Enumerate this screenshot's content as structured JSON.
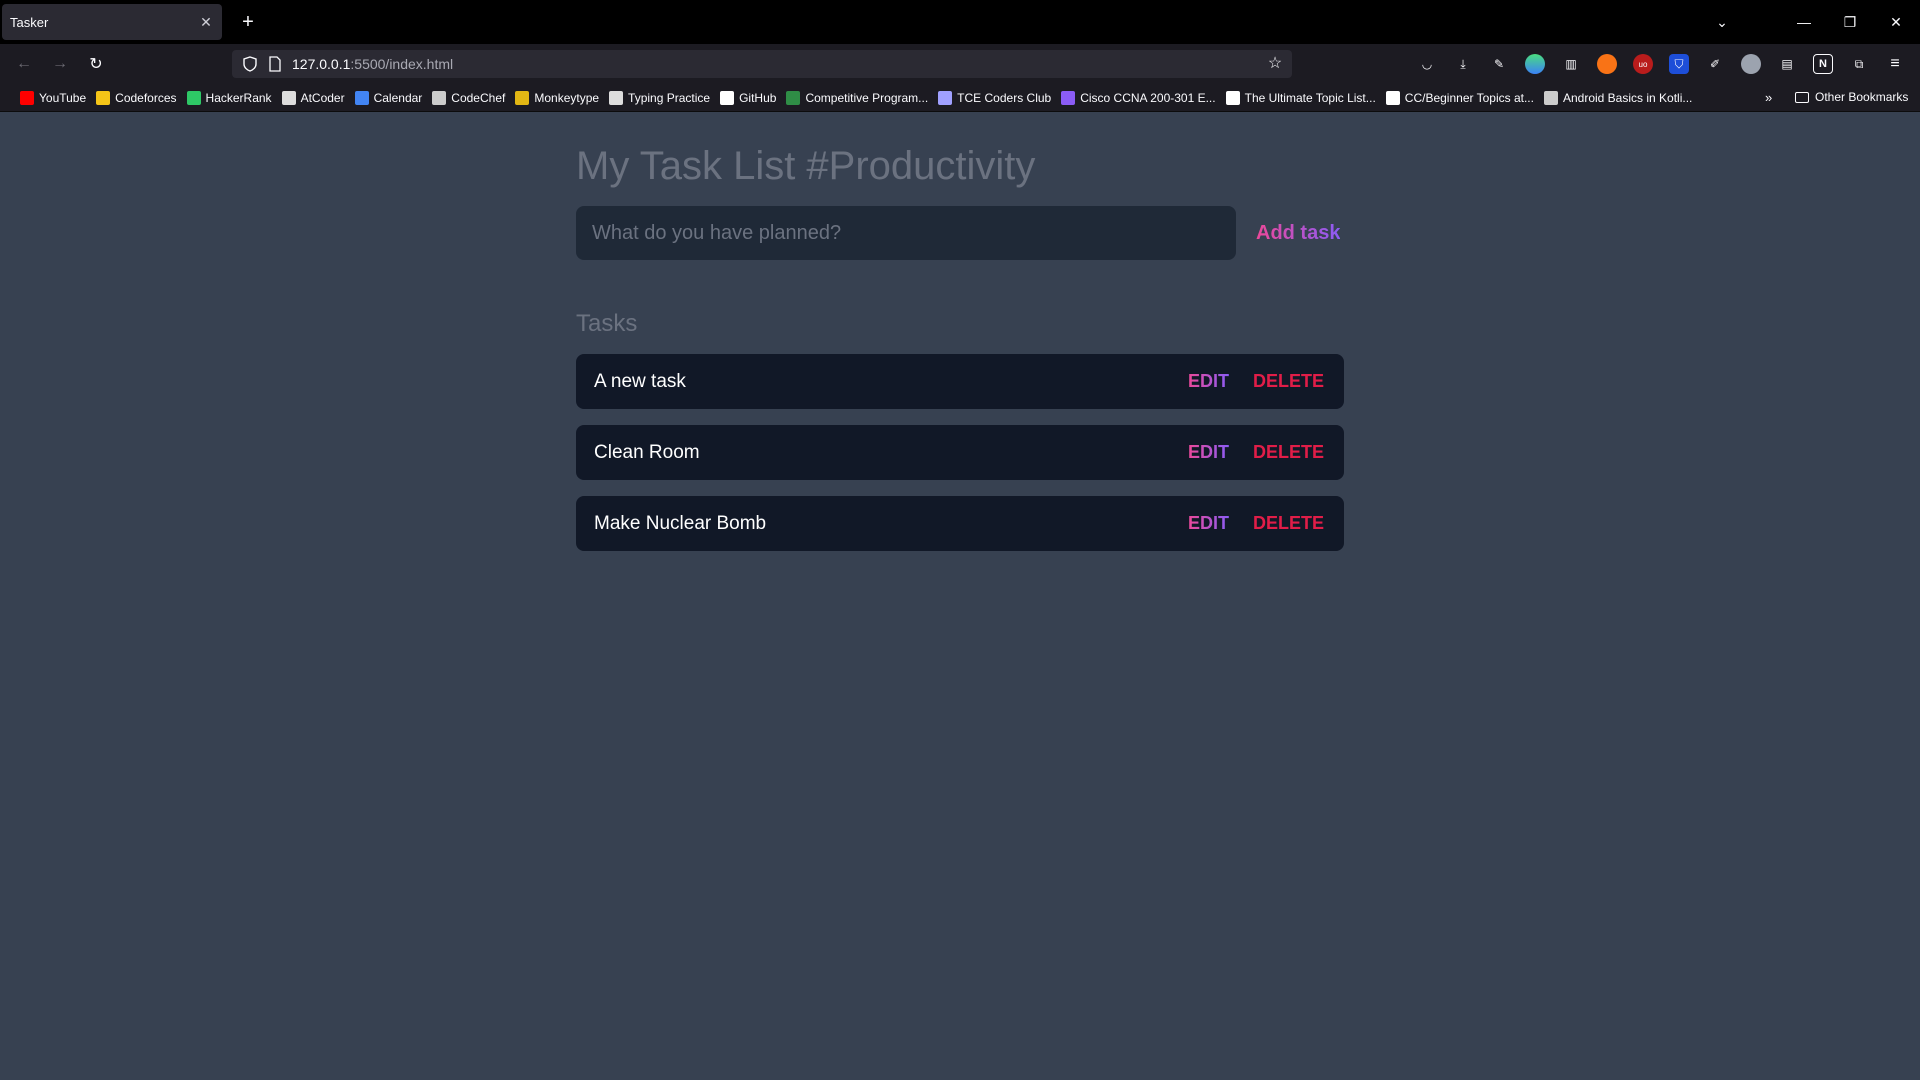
{
  "browser": {
    "tab_title": "Tasker",
    "url_host": "127.0.0.1",
    "url_path": ":5500/index.html",
    "bookmarks": [
      {
        "label": "YouTube",
        "color": "#ff0000"
      },
      {
        "label": "Codeforces",
        "color": "#f5c518"
      },
      {
        "label": "HackerRank",
        "color": "#2ec866"
      },
      {
        "label": "AtCoder",
        "color": "#dddddd"
      },
      {
        "label": "Calendar",
        "color": "#4285f4"
      },
      {
        "label": "CodeChef",
        "color": "#cccccc"
      },
      {
        "label": "Monkeytype",
        "color": "#e2b714"
      },
      {
        "label": "Typing Practice",
        "color": "#dddddd"
      },
      {
        "label": "GitHub",
        "color": "#ffffff"
      },
      {
        "label": "Competitive Program...",
        "color": "#2f8d46"
      },
      {
        "label": "TCE Coders Club",
        "color": "#a0a0ff"
      },
      {
        "label": "Cisco CCNA 200-301 E...",
        "color": "#8b5cf6"
      },
      {
        "label": "The Ultimate Topic List...",
        "color": "#ffffff"
      },
      {
        "label": "CC/Beginner Topics at...",
        "color": "#ffffff"
      },
      {
        "label": "Android Basics in Kotli...",
        "color": "#cccccc"
      }
    ],
    "other_bookmarks": "Other Bookmarks"
  },
  "app": {
    "title": "My Task List #Productivity",
    "input_placeholder": "What do you have planned?",
    "add_button": "Add task",
    "tasks_heading": "Tasks",
    "edit_label": "Edit",
    "delete_label": "Delete",
    "tasks": [
      {
        "text": "A new task"
      },
      {
        "text": "Clean Room"
      },
      {
        "text": "Make Nuclear Bomb"
      }
    ]
  }
}
